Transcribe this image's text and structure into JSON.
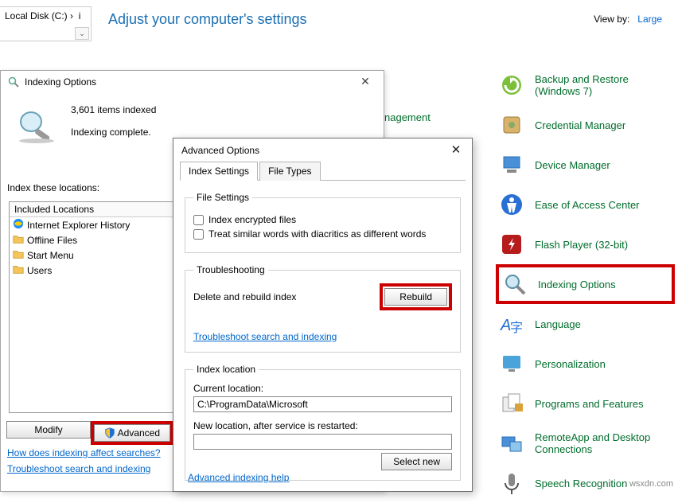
{
  "breadcrumb": {
    "label": "Local Disk (C:)",
    "arrow": "›",
    "hint": "i"
  },
  "controlPanel": {
    "title": "Adjust your computer's settings",
    "viewby_label": "View by:",
    "viewby_value": "Large",
    "stray": "nagement",
    "items": [
      {
        "label": "Backup and Restore (Windows 7)",
        "icon": "backup-icon"
      },
      {
        "label": "Credential Manager",
        "icon": "credential-icon"
      },
      {
        "label": "Device Manager",
        "icon": "device-icon"
      },
      {
        "label": "Ease of Access Center",
        "icon": "ease-icon"
      },
      {
        "label": "Flash Player (32-bit)",
        "icon": "flash-icon"
      },
      {
        "label": "Indexing Options",
        "icon": "index-icon",
        "highlight": true
      },
      {
        "label": "Language",
        "icon": "language-icon"
      },
      {
        "label": "Personalization",
        "icon": "personalization-icon"
      },
      {
        "label": "Programs and Features",
        "icon": "programs-icon"
      },
      {
        "label": "RemoteApp and Desktop Connections",
        "icon": "remote-icon"
      },
      {
        "label": "Speech Recognition",
        "icon": "speech-icon"
      }
    ]
  },
  "indexDialog": {
    "title": "Indexing Options",
    "items_count": "3,601 items indexed",
    "status": "Indexing complete.",
    "locations_label": "Index these locations:",
    "included_header": "Included Locations",
    "locations": [
      {
        "label": "Internet Explorer History",
        "icon": "ie-icon"
      },
      {
        "label": "Offline Files",
        "icon": "folder-icon"
      },
      {
        "label": "Start Menu",
        "icon": "folder-icon"
      },
      {
        "label": "Users",
        "icon": "folder-icon"
      }
    ],
    "buttons": {
      "modify": "Modify",
      "advanced": "Advanced"
    },
    "links": {
      "how": "How does indexing affect searches?",
      "ts": "Troubleshoot search and indexing"
    }
  },
  "advDialog": {
    "title": "Advanced Options",
    "tabs": {
      "settings": "Index Settings",
      "types": "File Types"
    },
    "fileSettings": {
      "legend": "File Settings",
      "encrypted": "Index encrypted files",
      "diacritics": "Treat similar words with diacritics as different words"
    },
    "troubleshoot": {
      "legend": "Troubleshooting",
      "delete": "Delete and rebuild index",
      "rebuild": "Rebuild",
      "link": "Troubleshoot search and indexing"
    },
    "indexLocation": {
      "legend": "Index location",
      "current_label": "Current location:",
      "current_value": "C:\\ProgramData\\Microsoft",
      "new_label": "New location, after service is restarted:",
      "new_value": "",
      "select": "Select new"
    },
    "adv_link": "Advanced indexing help"
  },
  "watermark": "wsxdn.com"
}
